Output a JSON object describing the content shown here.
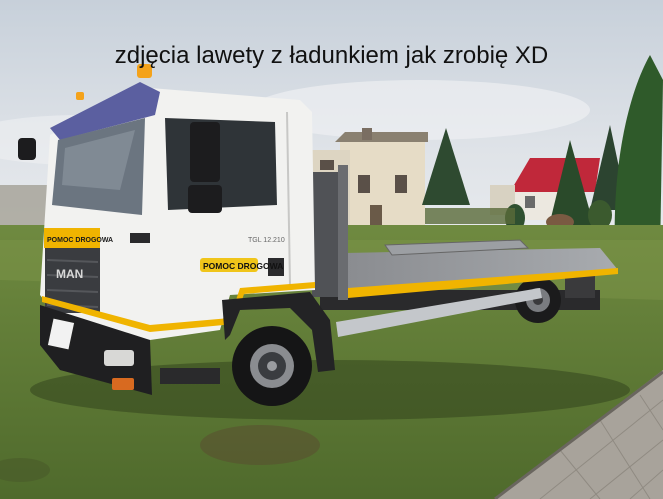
{
  "caption": "zdjęcia lawety z ładunkiem jak zrobię XD",
  "truck": {
    "door_label": "POMOC DROGOWA",
    "bumper_label": "POMOC DROGOWA",
    "brand": "MAN",
    "model": "TGL 12.210"
  },
  "colors": {
    "sky": "#d4dbe3",
    "grass": "#5d7a34",
    "cab": "#f2f2f0",
    "visor": "#5b5fa0",
    "stripe": "#f0b400",
    "roof": "#c0283a"
  }
}
